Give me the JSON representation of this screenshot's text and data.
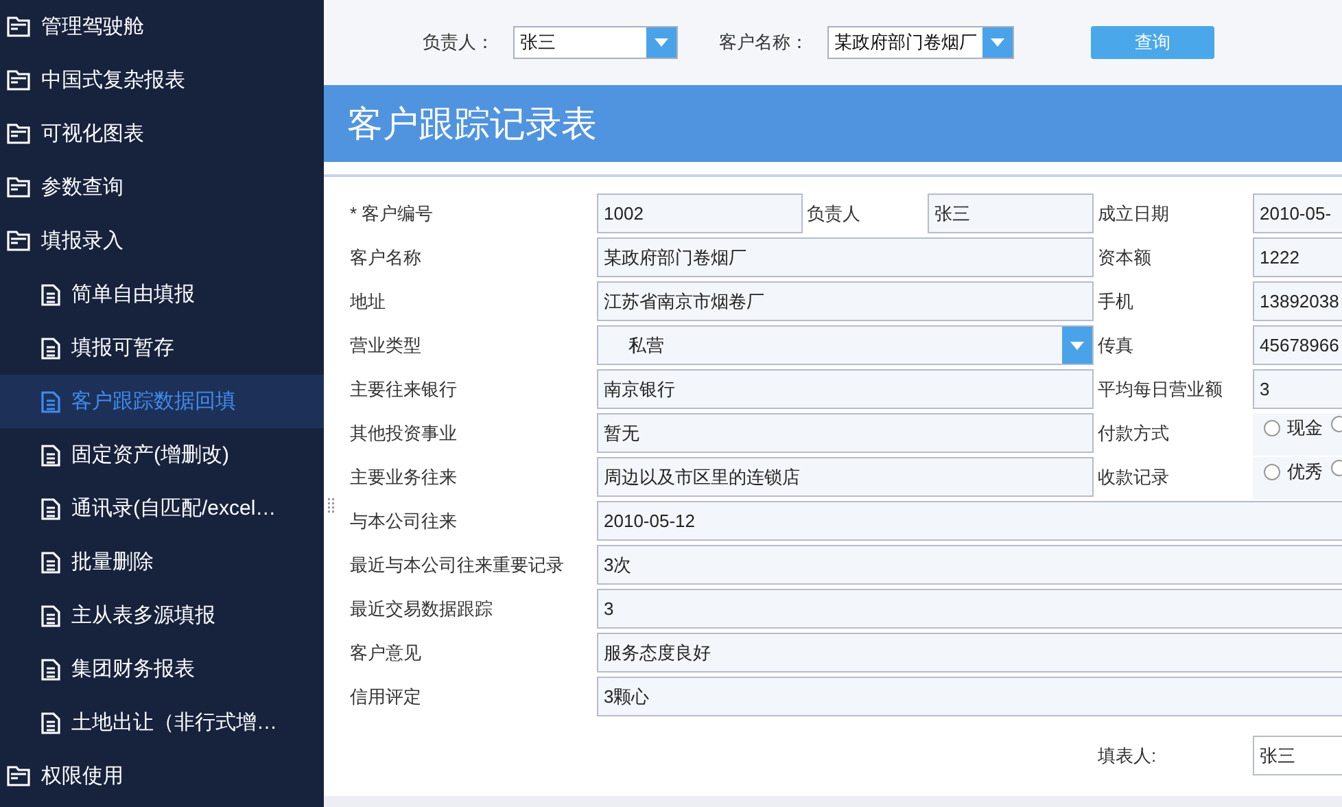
{
  "sidebar": {
    "items": [
      {
        "label": "管理驾驶舱",
        "kind": "folder",
        "selected": false
      },
      {
        "label": "中国式复杂报表",
        "kind": "folder",
        "selected": false
      },
      {
        "label": "可视化图表",
        "kind": "folder",
        "selected": false
      },
      {
        "label": "参数查询",
        "kind": "folder",
        "selected": false
      },
      {
        "label": "填报录入",
        "kind": "folder",
        "selected": false,
        "children": [
          {
            "label": "简单自由填报",
            "kind": "file",
            "selected": false
          },
          {
            "label": "填报可暂存",
            "kind": "file",
            "selected": false
          },
          {
            "label": "客户跟踪数据回填",
            "kind": "file",
            "selected": true
          },
          {
            "label": "固定资产(增删改)",
            "kind": "file",
            "selected": false
          },
          {
            "label": "通讯录(自匹配/excel…",
            "kind": "file",
            "selected": false
          },
          {
            "label": "批量删除",
            "kind": "file",
            "selected": false
          },
          {
            "label": "主从表多源填报",
            "kind": "file",
            "selected": false
          },
          {
            "label": "集团财务报表",
            "kind": "file",
            "selected": false
          },
          {
            "label": "土地出让（非行式增…",
            "kind": "file",
            "selected": false
          }
        ]
      },
      {
        "label": "权限使用",
        "kind": "folder",
        "selected": false
      }
    ]
  },
  "filter_bar": {
    "fields": [
      {
        "label": "负责人：",
        "value": "张三"
      },
      {
        "label": "客户名称：",
        "value": "某政府部门卷烟厂"
      }
    ],
    "button": "查询"
  },
  "title": "客户跟踪记录表",
  "form": {
    "rows": [
      {
        "kind": "three",
        "cells": [
          {
            "label": "* 客户编号",
            "kind": "text",
            "value": "1002"
          },
          {
            "label": "负责人",
            "kind": "text",
            "value": "张三"
          },
          {
            "label": "成立日期",
            "kind": "text",
            "value": "2010-05-"
          }
        ]
      },
      {
        "kind": "two",
        "cells": [
          {
            "label": "客户名称",
            "kind": "text",
            "value": "某政府部门卷烟厂"
          },
          {
            "label": "资本额",
            "kind": "text",
            "value": "1222"
          }
        ]
      },
      {
        "kind": "two",
        "cells": [
          {
            "label": "地址",
            "kind": "text",
            "value": "江苏省南京市烟卷厂"
          },
          {
            "label": "手机",
            "kind": "text",
            "value": "13892038"
          }
        ]
      },
      {
        "kind": "two",
        "cells": [
          {
            "label": "营业类型",
            "kind": "select",
            "value": "私营"
          },
          {
            "label": "传真",
            "kind": "text",
            "value": "45678966"
          }
        ]
      },
      {
        "kind": "two",
        "cells": [
          {
            "label": "主要往来银行",
            "kind": "text",
            "value": "南京银行"
          },
          {
            "label": "平均每日营业额",
            "kind": "text",
            "value": "3"
          }
        ]
      },
      {
        "kind": "two",
        "cells": [
          {
            "label": "其他投资事业",
            "kind": "text",
            "value": "暂无"
          },
          {
            "label": "付款方式",
            "kind": "radio",
            "options": [
              {
                "label": "现金",
                "selected": false
              },
              {
                "selected": false
              }
            ]
          }
        ]
      },
      {
        "kind": "two",
        "cells": [
          {
            "label": "主要业务往来",
            "kind": "text",
            "value": "周边以及市区里的连锁店"
          },
          {
            "label": "收款记录",
            "kind": "radio",
            "options": [
              {
                "label": "优秀",
                "selected": false
              },
              {
                "selected": false
              }
            ]
          }
        ]
      },
      {
        "kind": "full",
        "cells": [
          {
            "label": "与本公司往来",
            "kind": "text",
            "value": "2010-05-12"
          }
        ]
      },
      {
        "kind": "full",
        "cells": [
          {
            "label": "最近与本公司往来重要记录",
            "kind": "text",
            "value": "3次"
          }
        ]
      },
      {
        "kind": "full",
        "cells": [
          {
            "label": "最近交易数据跟踪",
            "kind": "text",
            "value": "3"
          }
        ]
      },
      {
        "kind": "full",
        "cells": [
          {
            "label": "客户意见",
            "kind": "text",
            "value": "服务态度良好"
          }
        ]
      },
      {
        "kind": "full",
        "cells": [
          {
            "label": "信用评定",
            "kind": "text",
            "value": "3颗心"
          }
        ]
      }
    ],
    "footer": {
      "label": "填表人:",
      "value": "张三"
    }
  }
}
